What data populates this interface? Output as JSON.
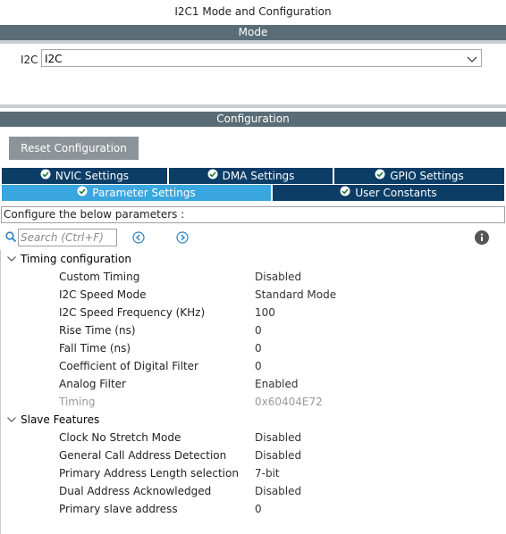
{
  "window_title": "I2C1 Mode and Configuration",
  "mode": {
    "header": "Mode",
    "i2c_label": "I2C",
    "i2c_value": "I2C"
  },
  "configuration": {
    "header": "Configuration",
    "reset_button": "Reset Configuration",
    "tabs_row1": [
      {
        "label": "NVIC Settings"
      },
      {
        "label": "DMA Settings"
      },
      {
        "label": "GPIO Settings"
      }
    ],
    "tabs_row2": [
      {
        "label": "Parameter Settings",
        "active": true
      },
      {
        "label": "User Constants",
        "active": false
      }
    ],
    "params_header": "Configure the below parameters :",
    "search_placeholder": "Search (Ctrl+F)",
    "groups": [
      {
        "label": "Timing configuration",
        "params": [
          {
            "name": "Custom Timing",
            "value": "Disabled"
          },
          {
            "name": "I2C Speed Mode",
            "value": "Standard Mode"
          },
          {
            "name": "I2C Speed Frequency (KHz)",
            "value": "100"
          },
          {
            "name": "Rise Time (ns)",
            "value": "0"
          },
          {
            "name": "Fall Time (ns)",
            "value": "0"
          },
          {
            "name": "Coefficient of Digital Filter",
            "value": "0"
          },
          {
            "name": "Analog Filter",
            "value": "Enabled"
          },
          {
            "name": "Timing",
            "value": "0x60404E72",
            "disabled": true
          }
        ]
      },
      {
        "label": "Slave Features",
        "params": [
          {
            "name": "Clock No Stretch Mode",
            "value": "Disabled"
          },
          {
            "name": "General Call Address Detection",
            "value": "Disabled"
          },
          {
            "name": "Primary Address Length selection",
            "value": "7-bit"
          },
          {
            "name": "Dual Address Acknowledged",
            "value": "Disabled"
          },
          {
            "name": "Primary slave address",
            "value": "0"
          }
        ]
      }
    ]
  },
  "colors": {
    "header_bar": "#5a6d77",
    "tab_dark": "#0b3d66",
    "tab_active": "#3aa6df",
    "reset_button": "#8d9499"
  },
  "icons": [
    "chevron-down-icon",
    "check-circle-icon",
    "search-icon",
    "prev-icon",
    "next-icon",
    "info-icon",
    "caret-down-icon"
  ]
}
